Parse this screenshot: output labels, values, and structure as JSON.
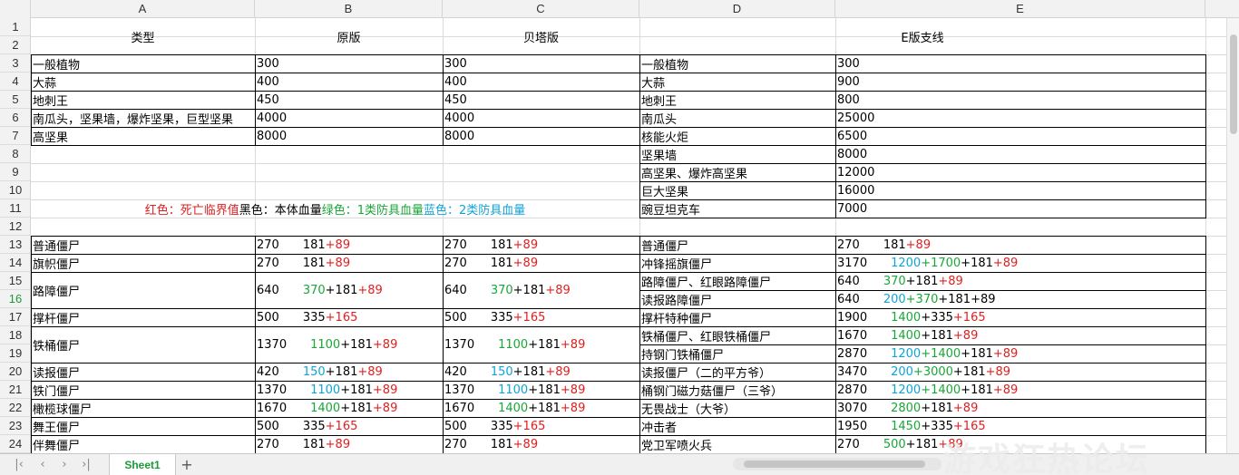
{
  "columns": [
    "A",
    "B",
    "C",
    "D",
    "E"
  ],
  "rows": [
    "1",
    "2",
    "3",
    "4",
    "5",
    "6",
    "7",
    "8",
    "9",
    "10",
    "11",
    "12",
    "13",
    "14",
    "15",
    "16",
    "17",
    "18",
    "19",
    "20",
    "21",
    "22",
    "23",
    "24"
  ],
  "header": {
    "type": "类型",
    "orig": "原版",
    "beta": "贝塔版",
    "ebranch": "E版支线"
  },
  "plants_left": [
    {
      "name": "一般植物",
      "orig": "300",
      "beta": "300"
    },
    {
      "name": "大蒜",
      "orig": "400",
      "beta": "400"
    },
    {
      "name": "地刺王",
      "orig": "450",
      "beta": "450"
    },
    {
      "name": "南瓜头，坚果墙，爆炸坚果，巨型坚果",
      "orig": "4000",
      "beta": "4000"
    },
    {
      "name": "高坚果",
      "orig": "8000",
      "beta": "8000"
    }
  ],
  "plants_right": [
    {
      "name": "一般植物",
      "hp": "300"
    },
    {
      "name": "大蒜",
      "hp": "900"
    },
    {
      "name": "地刺王",
      "hp": "800"
    },
    {
      "name": "南瓜头",
      "hp": "25000"
    },
    {
      "name": "核能火炬",
      "hp": "6500"
    },
    {
      "name": "坚果墙",
      "hp": "8000"
    },
    {
      "name": "高坚果、爆炸高坚果",
      "hp": "12000"
    },
    {
      "name": "巨大坚果",
      "hp": "16000"
    },
    {
      "name": "豌豆坦克车",
      "hp": "7000"
    }
  ],
  "legend": {
    "red": "红色：死亡临界值",
    "black": "黑色：本体血量",
    "green": "绿色：1类防具血量",
    "blue": "蓝色：2类防具血量"
  },
  "zombies_left": [
    {
      "name": "普通僵尸",
      "v": [
        "270",
        "",
        "",
        "181",
        "89"
      ]
    },
    {
      "name": "旗帜僵尸",
      "v": [
        "270",
        "",
        "",
        "181",
        "89"
      ]
    },
    {
      "name": "路障僵尸",
      "v": [
        "640",
        "370",
        "",
        "181",
        "89"
      ]
    },
    {
      "name": "撑杆僵尸",
      "v": [
        "500",
        "",
        "",
        "335",
        "165"
      ]
    },
    {
      "name": "铁桶僵尸",
      "v": [
        "1370",
        "1100",
        "",
        "181",
        "89"
      ]
    },
    {
      "name": "读报僵尸",
      "v": [
        "420",
        "",
        "150",
        "181",
        "89"
      ]
    },
    {
      "name": "铁门僵尸",
      "v": [
        "1370",
        "",
        "1100",
        "181",
        "89"
      ]
    },
    {
      "name": "橄榄球僵尸",
      "v": [
        "1670",
        "1400",
        "",
        "181",
        "89"
      ]
    },
    {
      "name": "舞王僵尸",
      "v": [
        "500",
        "",
        "",
        "335",
        "165"
      ]
    },
    {
      "name": "伴舞僵尸",
      "v": [
        "270",
        "",
        "",
        "181",
        "89"
      ]
    }
  ],
  "zombies_right": [
    {
      "name": "普通僵尸",
      "v": [
        "270",
        "",
        "",
        "181",
        "89"
      ]
    },
    {
      "name": "冲锋摇旗僵尸",
      "v": [
        "3170",
        "1700",
        "1200",
        "181",
        "89"
      ]
    },
    {
      "name": "路障僵尸、红眼路障僵尸",
      "v": [
        "640",
        "370",
        "",
        "181",
        "89"
      ]
    },
    {
      "name": "读报路障僵尸",
      "v": [
        "640",
        "370",
        "200",
        "181",
        ""
      ],
      "last_black": "89"
    },
    {
      "name": "撑杆特种僵尸",
      "v": [
        "1900",
        "1400",
        "",
        "335",
        "165"
      ]
    },
    {
      "name": "铁桶僵尸、红眼铁桶僵尸",
      "v": [
        "1670",
        "1400",
        "",
        "181",
        "89"
      ]
    },
    {
      "name": "持钢门铁桶僵尸",
      "v": [
        "2870",
        "1400",
        "1200",
        "181",
        "89"
      ]
    },
    {
      "name": "读报僵尸（二的平方爷）",
      "v": [
        "3470",
        "3000",
        "200",
        "181",
        "89"
      ]
    },
    {
      "name": "桶钢门磁力菇僵尸（三爷）",
      "v": [
        "2870",
        "1400",
        "1200",
        "181",
        "89"
      ]
    },
    {
      "name": "无畏战士（大爷）",
      "v": [
        "3070",
        "2800",
        "",
        "181",
        "89"
      ]
    },
    {
      "name": "冲击者",
      "v": [
        "1950",
        "1450",
        "",
        "335",
        "165"
      ]
    },
    {
      "name": "党卫军喷火兵",
      "v": [
        "270",
        "500",
        "",
        "181",
        "89"
      ]
    }
  ],
  "sheet_tab": "Sheet1",
  "watermark": "游戏狂热论坛",
  "colors": {
    "green": "#1aa637",
    "blue": "#11a3d8",
    "red": "#e02020",
    "tab": "#1b9a3a"
  }
}
